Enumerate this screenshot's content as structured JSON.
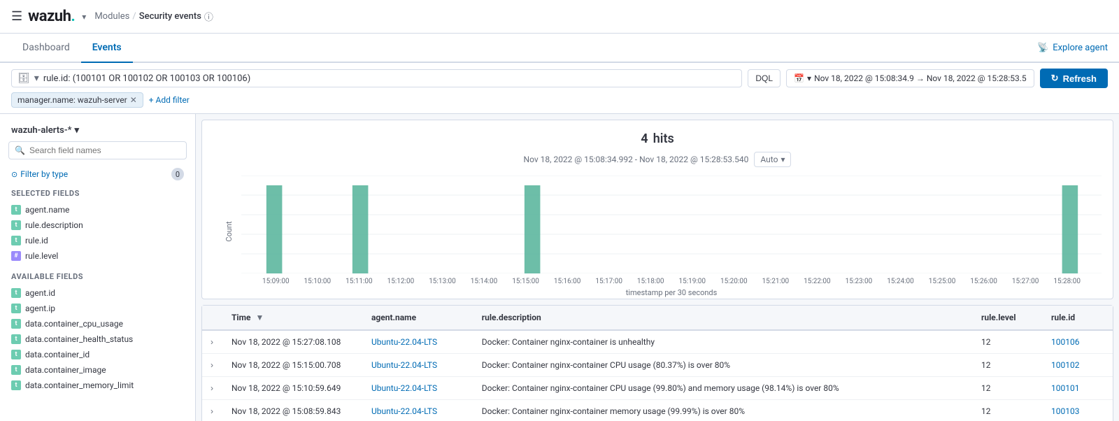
{
  "app": {
    "logo": "wazuh.",
    "logo_accent": ".",
    "hamburger_icon": "☰",
    "caret_icon": "▾",
    "info_icon": "ⓘ"
  },
  "breadcrumb": {
    "modules_label": "Modules",
    "separator": "/",
    "current": "Security events"
  },
  "tabs": {
    "dashboard_label": "Dashboard",
    "events_label": "Events",
    "explore_agent_label": "Explore agent"
  },
  "filter_bar": {
    "query": "rule.id: (100101 OR 100102 OR 100103 OR 100106)",
    "dql_label": "DQL",
    "calendar_icon": "📅",
    "date_range": "Nov 18, 2022 @ 15:08:34.9  →  Nov 18, 2022 @ 15:28:53.5",
    "refresh_label": "Refresh",
    "refresh_icon": "↻",
    "filter_tag": "manager.name: wazuh-server",
    "add_filter_label": "+ Add filter"
  },
  "sidebar": {
    "index_label": "wazuh-alerts-*",
    "caret_icon": "▾",
    "search_placeholder": "Search field names",
    "filter_type_label": "Filter by type",
    "filter_badge": "0",
    "selected_fields_label": "Selected fields",
    "selected_fields": [
      {
        "name": "agent.name",
        "type": "t"
      },
      {
        "name": "rule.description",
        "type": "t"
      },
      {
        "name": "rule.id",
        "type": "t"
      },
      {
        "name": "rule.level",
        "type": "hash"
      }
    ],
    "available_fields_label": "Available fields",
    "available_fields": [
      {
        "name": "agent.id",
        "type": "t"
      },
      {
        "name": "agent.ip",
        "type": "t"
      },
      {
        "name": "data.container_cpu_usage",
        "type": "t"
      },
      {
        "name": "data.container_health_status",
        "type": "t"
      },
      {
        "name": "data.container_id",
        "type": "t"
      },
      {
        "name": "data.container_image",
        "type": "t"
      },
      {
        "name": "data.container_memory_limit",
        "type": "t"
      }
    ]
  },
  "chart": {
    "hits_count": "4",
    "hits_label": "hits",
    "date_range": "Nov 18, 2022 @ 15:08:34.992 - Nov 18, 2022 @ 15:28:53.540",
    "auto_label": "Auto",
    "y_axis_label": "Count",
    "x_axis_label": "timestamp per 30 seconds",
    "x_ticks": [
      "15:09:00",
      "15:10:00",
      "15:11:00",
      "15:12:00",
      "15:13:00",
      "15:14:00",
      "15:15:00",
      "15:16:00",
      "15:17:00",
      "15:18:00",
      "15:19:00",
      "15:20:00",
      "15:21:00",
      "15:22:00",
      "15:23:00",
      "15:24:00",
      "15:25:00",
      "15:26:00",
      "15:27:00",
      "15:28:00"
    ],
    "y_ticks": [
      "0",
      "0.2",
      "0.4",
      "0.6",
      "0.8",
      "1"
    ],
    "bars": [
      {
        "x_label": "15:09:00",
        "height_pct": 90
      },
      {
        "x_label": "15:11:00",
        "height_pct": 90
      },
      {
        "x_label": "15:15:00",
        "height_pct": 90
      },
      {
        "x_label": "15:27:30",
        "height_pct": 90
      }
    ]
  },
  "table": {
    "columns": [
      "",
      "Time",
      "agent.name",
      "rule.description",
      "rule.level",
      "rule.id"
    ],
    "sort_col": "Time",
    "sort_dir": "▼",
    "rows": [
      {
        "time": "Nov 18, 2022 @ 15:27:08.108",
        "agent_name": "Ubuntu-22.04-LTS",
        "rule_description": "Docker: Container nginx-container is unhealthy",
        "rule_level": "12",
        "rule_id": "100106"
      },
      {
        "time": "Nov 18, 2022 @ 15:15:00.708",
        "agent_name": "Ubuntu-22.04-LTS",
        "rule_description": "Docker: Container nginx-container CPU usage (80.37%) is over 80%",
        "rule_level": "12",
        "rule_id": "100102"
      },
      {
        "time": "Nov 18, 2022 @ 15:10:59.649",
        "agent_name": "Ubuntu-22.04-LTS",
        "rule_description": "Docker: Container nginx-container CPU usage (99.80%) and memory usage (98.14%) is over 80%",
        "rule_level": "12",
        "rule_id": "100101"
      },
      {
        "time": "Nov 18, 2022 @ 15:08:59.843",
        "agent_name": "Ubuntu-22.04-LTS",
        "rule_description": "Docker: Container nginx-container memory usage (99.99%) is over 80%",
        "rule_level": "12",
        "rule_id": "100103"
      }
    ]
  }
}
